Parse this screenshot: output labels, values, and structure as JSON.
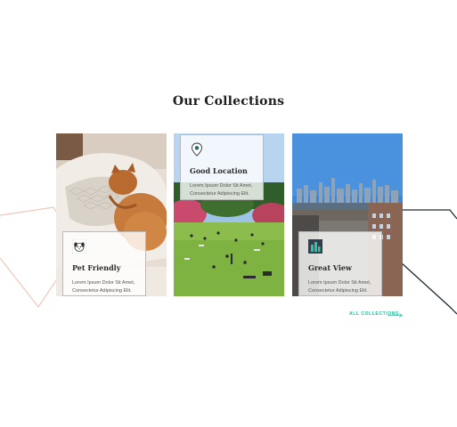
{
  "section": {
    "title": "Our Collections"
  },
  "cards": [
    {
      "title": "Pet Friendly",
      "desc_line1": "Lorem Ipsum Dolor Sit Amet,",
      "desc_line2": "Consectetur Adipiscing Elit.",
      "icon": "dog-icon"
    },
    {
      "title": "Good Location",
      "desc_line1": "Lorem Ipsum Dolor Sit Amet,",
      "desc_line2": "Consectetur Adipiscing Elit.",
      "icon": "map-pin-icon"
    },
    {
      "title": "Great View",
      "desc_line1": "Lorem Ipsum Dolor Sit Amet,",
      "desc_line2": "Consectetur Adipiscing Elit.",
      "icon": "city-view-icon"
    }
  ],
  "link": {
    "label": "ALL COLLECTIONS"
  },
  "colors": {
    "accent": "#28b79a",
    "pink_line": "#f3c7bc",
    "dark_line": "#1f2a33"
  }
}
